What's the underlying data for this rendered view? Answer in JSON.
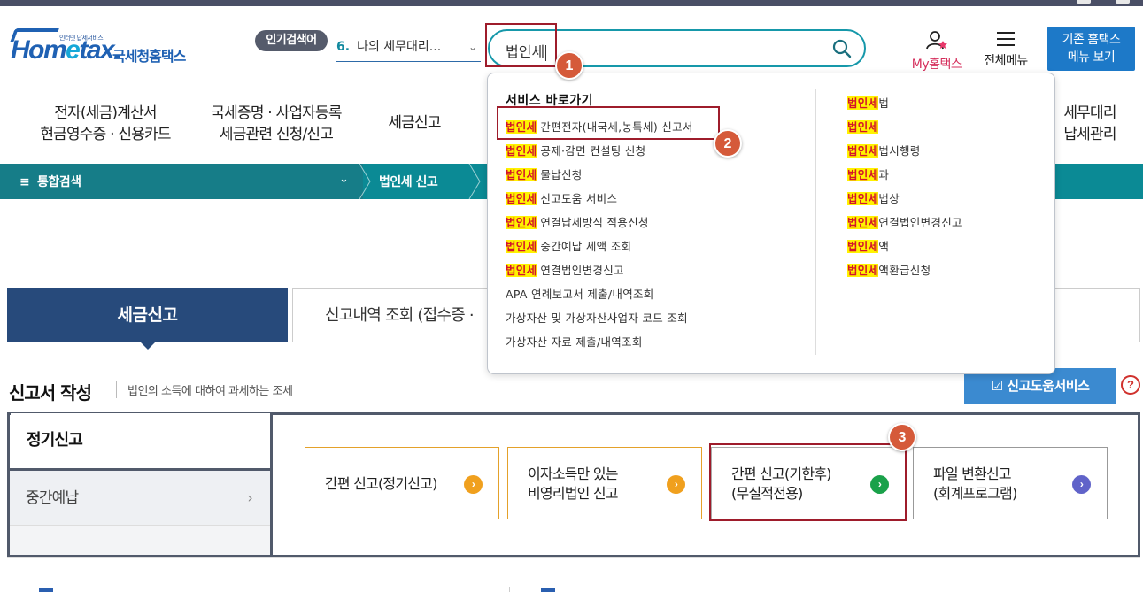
{
  "logo": {
    "tagline": "인터넷 납세서비스",
    "brand": "Hometax.",
    "brand_kor": "국세청홈택스"
  },
  "popular_search": {
    "badge": "인기검색어",
    "rank": "6.",
    "item": "나의 세무대리..."
  },
  "search": {
    "value": "법인세"
  },
  "header_links": {
    "myhometax": "My홈택스",
    "all_menu": "전체메뉴",
    "old_home_line1": "기존 홈택스",
    "old_home_line2": "메뉴 보기"
  },
  "main_nav": [
    {
      "l1": "전자(세금)계산서",
      "l2": "현금영수증 · 신용카드"
    },
    {
      "l1": "국세증명 · 사업자등록",
      "l2": "세금관련 신청/신고"
    },
    {
      "l1": "세금신고",
      "l2": ""
    },
    {
      "l1": "세무대리",
      "l2": "납세관리"
    }
  ],
  "breadcrumb": {
    "root": "통합검색",
    "current": "법인세 신고"
  },
  "tabs": {
    "active": "세금신고",
    "second": "신고내역 조회 (접수증 ·"
  },
  "section": {
    "title": "신고서 작성",
    "desc": "법인의 소득에 대하여 과세하는 조세",
    "help_button": "신고도움서비스",
    "help_q": "?"
  },
  "side_menu": {
    "active": "정기신고",
    "item": "중간예납"
  },
  "cards": [
    {
      "l1": "간편 신고(정기신고)",
      "l2": ""
    },
    {
      "l1": "이자소득만 있는",
      "l2": "비영리법인 신고"
    },
    {
      "l1": "간편 신고(기한후)",
      "l2": "(무실적전용)"
    },
    {
      "l1": "파일 변환신고",
      "l2": "(회계프로그램)"
    }
  ],
  "steps": [
    "1",
    "2",
    "3"
  ],
  "dropdown": {
    "header": "서비스 바로가기",
    "keyword": "법인세",
    "left": [
      {
        "kw": "법인세",
        "rest": "간편전자(내국세,농특세) 신고서"
      },
      {
        "kw": "법인세",
        "rest": "공제·감면 컨설팅 신청"
      },
      {
        "kw": "법인세",
        "rest": "물납신청"
      },
      {
        "kw": "법인세",
        "rest": "신고도움 서비스"
      },
      {
        "kw": "법인세",
        "rest": "연결납세방식 적용신청"
      },
      {
        "kw": "법인세",
        "rest": "중간예납 세액 조회"
      },
      {
        "kw": "법인세",
        "rest": "연결법인변경신고"
      },
      {
        "kw": "",
        "rest": "APA 연례보고서 제출/내역조회"
      },
      {
        "kw": "",
        "rest": "가상자산 및 가상자산사업자 코드 조회"
      },
      {
        "kw": "",
        "rest": "가상자산 자료 제출/내역조회"
      }
    ],
    "right": [
      {
        "kw": "법인세",
        "rest": "법"
      },
      {
        "kw": "법인세",
        "rest": ""
      },
      {
        "kw": "법인세",
        "rest": "법시행령"
      },
      {
        "kw": "법인세",
        "rest": "과"
      },
      {
        "kw": "법인세",
        "rest": "법상"
      },
      {
        "kw": "법인세",
        "rest": "연결법인변경신고"
      },
      {
        "kw": "법인세",
        "rest": "액"
      },
      {
        "kw": "법인세",
        "rest": "액환급신청"
      }
    ]
  }
}
